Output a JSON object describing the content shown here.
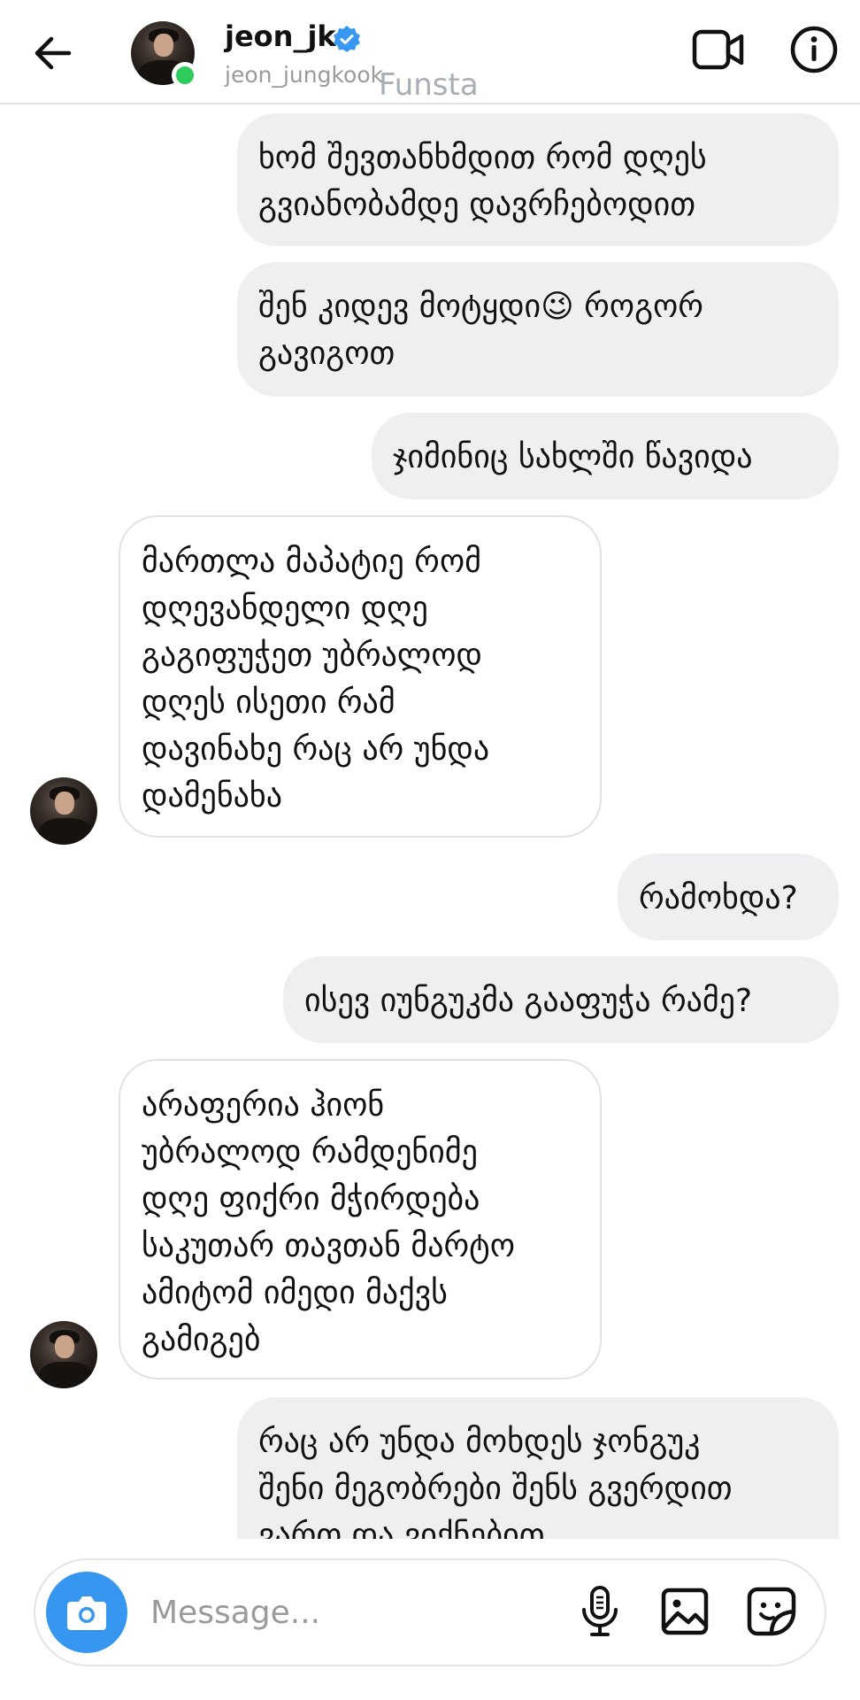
{
  "header": {
    "name": "jeon_jk",
    "username": "jeon_jungkook",
    "watermark": "Funsta"
  },
  "messages": [
    {
      "from": "me",
      "text": "ხომ შევთანხმდით რომ დღეს\nგვიანობამდე დავრჩებოდით"
    },
    {
      "from": "me",
      "text": "შენ კიდევ მოტყდი😉 როგორ\nგავიგოთ"
    },
    {
      "from": "me",
      "text": "ჯიმინიც სახლში წავიდა"
    },
    {
      "from": "them",
      "text": "მართლა მაპატიე რომ\nდღევანდელი დღე\nგაგიფუჭეთ უბრალოდ\nდღეს ისეთი რამ\nდავინახე რაც არ უნდა\nდამენახა"
    },
    {
      "from": "me",
      "text": "რამოხდა?"
    },
    {
      "from": "me",
      "text": "ისევ იუნგუკმა გააფუჭა რამე?"
    },
    {
      "from": "them",
      "text": "არაფერია ჰიონ\nუბრალოდ რამდენიმე\nდღე ფიქრი მჭირდება\nსაკუთარ თავთან მარტო\nამიტომ იმედი მაქვს\nგამიგებ"
    },
    {
      "from": "me",
      "text": "რაც არ უნდა მოხდეს ჯონგუკ\nშენი მეგობრები შენს გვერდით\nვართ და ვიქნებით"
    }
  ],
  "composer": {
    "placeholder": "Message..."
  },
  "colors": {
    "accent": "#3797f0",
    "online": "#2ecc5a",
    "sent_bubble": "#efeef1",
    "verified": "#3897f0"
  },
  "icons": {
    "back": "arrow-left-icon",
    "verified": "verified-badge-icon",
    "video": "video-call-icon",
    "info": "info-icon",
    "camera": "camera-icon",
    "mic": "microphone-icon",
    "gallery": "gallery-icon",
    "sticker": "sticker-icon"
  }
}
